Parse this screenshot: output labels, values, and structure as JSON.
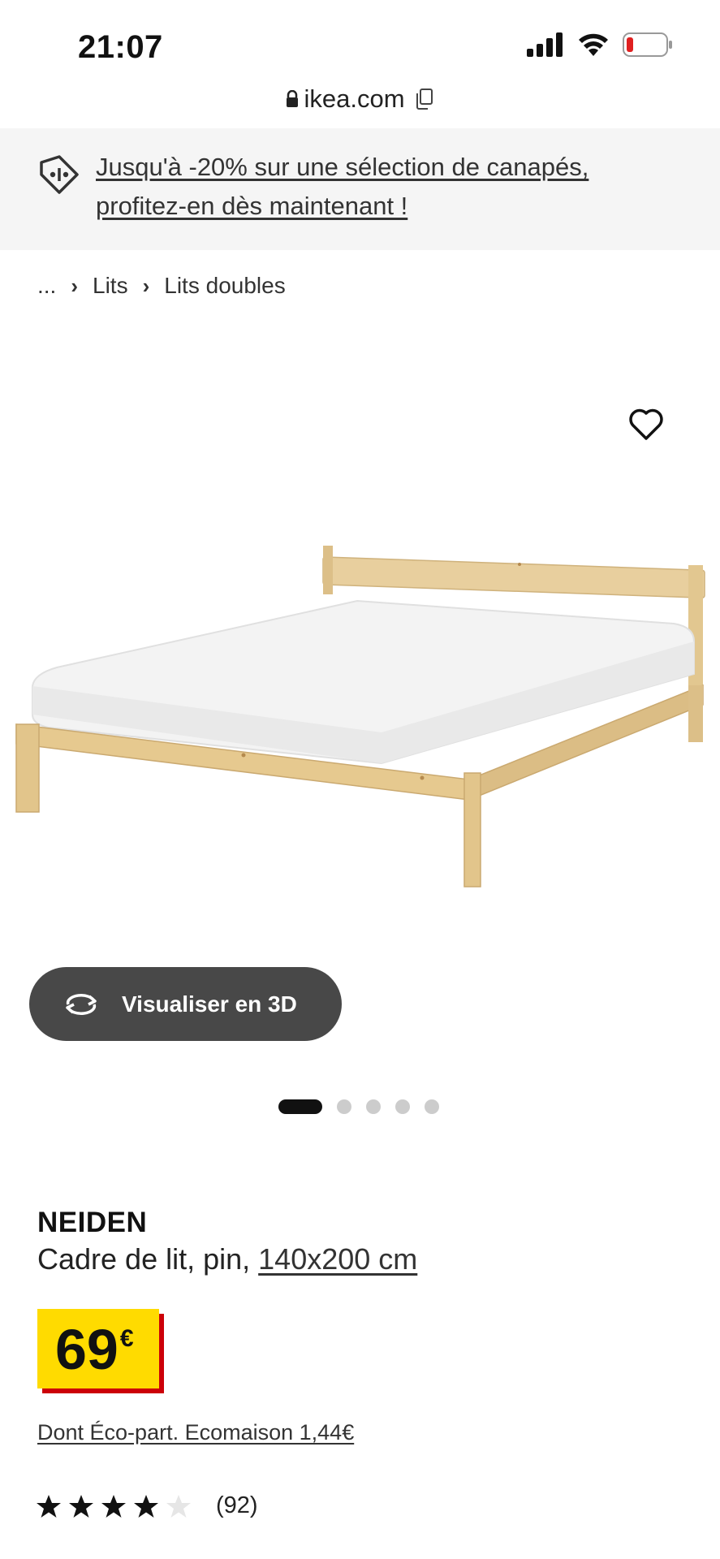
{
  "status_bar": {
    "time": "21:07"
  },
  "browser": {
    "url": "ikea.com"
  },
  "promo": {
    "text": "Jusqu'à -20% sur une sélection de canapés, profitez-en dès maintenant !"
  },
  "breadcrumb": {
    "ellipsis": "...",
    "items": [
      "Lits",
      "Lits doubles"
    ]
  },
  "product": {
    "name": "NEIDEN",
    "description": "Cadre de lit, pin, ",
    "size_link": "140x200 cm",
    "price_amount": "69",
    "price_currency": "€",
    "eco_part": "Dont Éco-part. Ecomaison 1,44€",
    "rating_value": 4,
    "rating_max": 5,
    "review_count": "(92)"
  },
  "view_3d": {
    "label": "Visualiser en 3D"
  },
  "carousel": {
    "total": 5,
    "active_index": 0
  },
  "colors": {
    "price_bg": "#ffdb00",
    "price_shadow": "#cc0008",
    "button_3d": "#484848",
    "promo_bg": "#f5f5f5"
  },
  "icons": [
    "signal-icon",
    "wifi-icon",
    "battery-icon",
    "lock-icon",
    "copy-icon",
    "price-tag-icon",
    "chevron-right-icon",
    "heart-icon",
    "rotate-3d-icon",
    "star-icon"
  ]
}
